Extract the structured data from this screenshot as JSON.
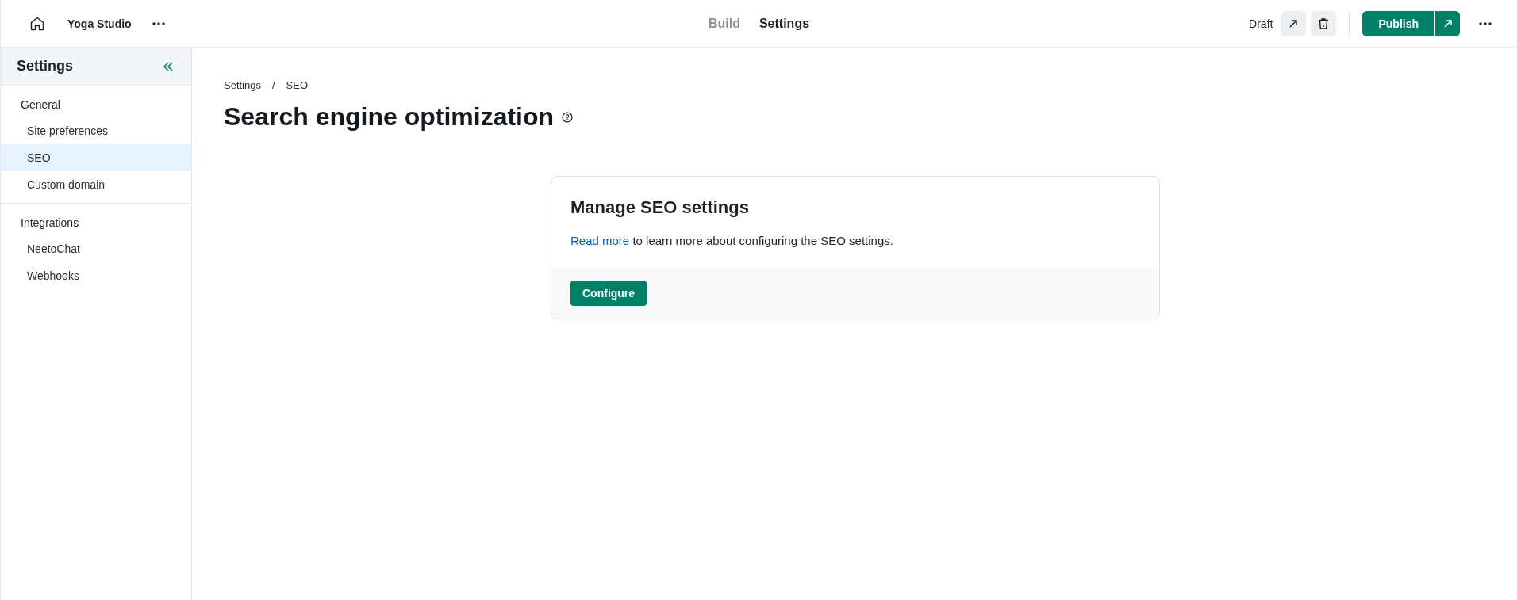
{
  "header": {
    "site_name": "Yoga Studio",
    "tabs": [
      {
        "label": "Build",
        "selected": false
      },
      {
        "label": "Settings",
        "selected": true
      }
    ],
    "status": "Draft",
    "publish_label": "Publish"
  },
  "sidebar": {
    "title": "Settings",
    "groups": [
      {
        "label": "General",
        "items": [
          {
            "label": "Site preferences",
            "selected": false
          },
          {
            "label": "SEO",
            "selected": true
          },
          {
            "label": "Custom domain",
            "selected": false
          }
        ]
      },
      {
        "label": "Integrations",
        "items": [
          {
            "label": "NeetoChat",
            "selected": false
          },
          {
            "label": "Webhooks",
            "selected": false
          }
        ]
      }
    ]
  },
  "breadcrumb": {
    "separator": "/",
    "items": [
      "Settings",
      "SEO"
    ]
  },
  "page_title": "Search engine optimization",
  "card": {
    "title": "Manage SEO settings",
    "link": "Read more",
    "text": "to learn more about configuring the SEO settings.",
    "button": "Configure"
  }
}
